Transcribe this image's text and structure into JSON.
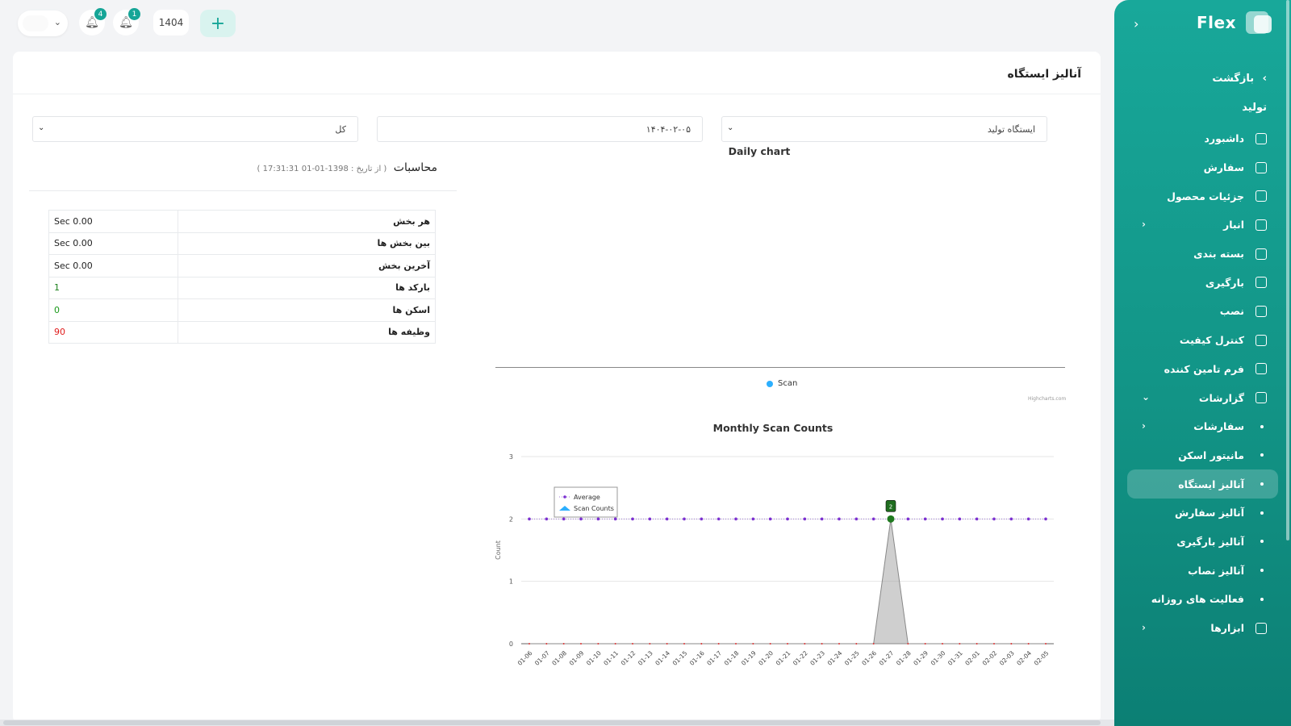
{
  "topbar": {
    "notifications_count": "4",
    "alerts_count": "1",
    "year": "1404",
    "add_label": "+"
  },
  "sidebar": {
    "logo": "Flex",
    "back_label": "بازگشت",
    "section_title": "تولید",
    "items": [
      {
        "label": "داشبورد",
        "icon": "home-icon"
      },
      {
        "label": "سفارش",
        "icon": "order-icon"
      },
      {
        "label": "جزئیات محصول",
        "icon": "chart-line-icon"
      },
      {
        "label": "انبار",
        "icon": "warehouse-icon",
        "arrow": "‹"
      },
      {
        "label": "بسته بندی",
        "icon": "package-icon"
      },
      {
        "label": "بارگیری",
        "icon": "box-icon"
      },
      {
        "label": "نصب",
        "icon": "install-icon"
      },
      {
        "label": "کنترل کیفیت",
        "icon": "quality-icon"
      },
      {
        "label": "فرم تامین کننده",
        "icon": "form-icon"
      },
      {
        "label": "گزارشات",
        "icon": "report-icon",
        "arrow": "⌄"
      },
      {
        "label": "سفارشات",
        "sub": true,
        "arrow": "‹"
      },
      {
        "label": "مانیتور اسکن",
        "sub": true
      },
      {
        "label": "آنالیز ایستگاه",
        "sub": true,
        "active": true
      },
      {
        "label": "آنالیز سفارش",
        "sub": true
      },
      {
        "label": "آنالیز بارگیری",
        "sub": true
      },
      {
        "label": "آنالیز نصاب",
        "sub": true
      },
      {
        "label": "فعالیت های روزانه",
        "sub": true
      },
      {
        "label": "ابزارها",
        "icon": "tools-icon",
        "arrow": "‹"
      }
    ]
  },
  "page": {
    "title": "آنالیز ایستگاه"
  },
  "filters": {
    "station": "ایستگاه تولید",
    "date": "۱۴۰۴-۰۲-۰۵",
    "scope": "کل"
  },
  "calc": {
    "title": "محاسبات",
    "subtitle": "( از تاریخ : 1398-01-01 17:31:31 )",
    "rows": [
      {
        "label": "هر بخش",
        "value": "Sec 0.00",
        "color": "#222222"
      },
      {
        "label": "بین بخش ها",
        "value": "Sec 0.00",
        "color": "#222222"
      },
      {
        "label": "آخرین بخش",
        "value": "Sec 0.00",
        "color": "#222222"
      },
      {
        "label": "بارکد ها",
        "value": "1",
        "color": "#1a7f1a"
      },
      {
        "label": "اسکن ها",
        "value": "0",
        "color": "#1a9a1a"
      },
      {
        "label": "وظیفه ها",
        "value": "90",
        "color": "#e01b1b"
      }
    ]
  },
  "chart_data": [
    {
      "type": "bar",
      "title": "Daily chart",
      "series": [
        {
          "name": "Scan",
          "values": []
        }
      ],
      "credit": "Highcharts.com",
      "colors": {
        "Scan": "#2caffe"
      }
    },
    {
      "type": "area",
      "title": "Monthly Scan Counts",
      "ylabel": "Count",
      "ylim": [
        0,
        3
      ],
      "yticks": [
        "0",
        "1",
        "2",
        "3"
      ],
      "categories": [
        "01-06",
        "01-07",
        "01-08",
        "01-09",
        "01-10",
        "01-11",
        "01-12",
        "01-13",
        "01-14",
        "01-15",
        "01-16",
        "01-17",
        "01-18",
        "01-19",
        "01-20",
        "01-21",
        "01-22",
        "01-23",
        "01-24",
        "01-25",
        "01-26",
        "01-27",
        "01-28",
        "01-29",
        "01-30",
        "01-31",
        "02-01",
        "02-02",
        "02-03",
        "02-04",
        "02-05"
      ],
      "series": [
        {
          "name": "Average",
          "values": [
            2,
            2,
            2,
            2,
            2,
            2,
            2,
            2,
            2,
            2,
            2,
            2,
            2,
            2,
            2,
            2,
            2,
            2,
            2,
            2,
            2,
            2,
            2,
            2,
            2,
            2,
            2,
            2,
            2,
            2,
            2
          ],
          "color": "#7b2fd0"
        },
        {
          "name": "Scan Counts",
          "values": [
            0,
            0,
            0,
            0,
            0,
            0,
            0,
            0,
            0,
            0,
            0,
            0,
            0,
            0,
            0,
            0,
            0,
            0,
            0,
            0,
            0,
            2,
            0,
            0,
            0,
            0,
            0,
            0,
            0,
            0,
            0
          ],
          "color": "#2caffe"
        }
      ],
      "data_label": {
        "category": "01-27",
        "value": "2"
      },
      "legend": "top-left",
      "grid": true
    }
  ]
}
